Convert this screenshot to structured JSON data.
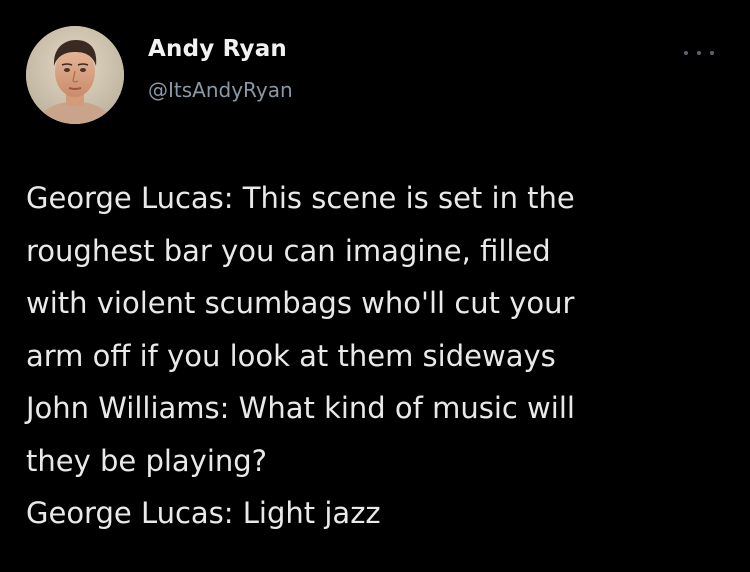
{
  "tweet": {
    "author": {
      "display_name": "Andy Ryan",
      "handle": "@ItsAndyRyan",
      "avatar_icon": "user-avatar-portrait"
    },
    "more_icon": "more-options-icon",
    "lines": [
      "George Lucas: This scene is set in the",
      "roughest bar you can imagine, filled",
      "with violent scumbags who'll cut your",
      "arm off if you look at them sideways",
      "John Williams: What kind of music will",
      "they be playing?",
      "George Lucas: Light jazz"
    ]
  },
  "colors": {
    "background": "#000000",
    "text": "#e9e9e9",
    "secondary_text": "#8b98a5"
  }
}
